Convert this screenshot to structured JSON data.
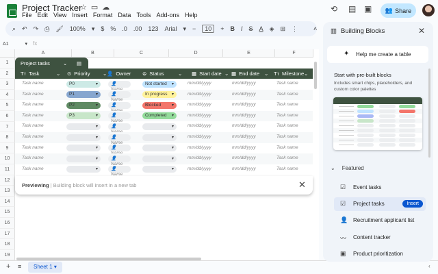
{
  "app": {
    "title": "Project Tracker",
    "menu": [
      "File",
      "Edit",
      "View",
      "Insert",
      "Format",
      "Data",
      "Tools",
      "Add-ons",
      "Help"
    ],
    "share_label": "Share"
  },
  "toolbar": {
    "zoom": "100%",
    "currency": "$",
    "percent": "%",
    "number_format": "123",
    "font": "Arial",
    "font_size": "10"
  },
  "formula_bar": {
    "name_box": "A1",
    "fx": "fx"
  },
  "columns": [
    "A",
    "B",
    "C",
    "D",
    "E",
    "F"
  ],
  "rows": [
    "1",
    "2",
    "3",
    "4",
    "5",
    "6",
    "7",
    "8",
    "9",
    "10",
    "11",
    "12",
    "13",
    "14",
    "15",
    "16",
    "17",
    "18",
    "19"
  ],
  "table": {
    "name": "Project tasks",
    "headers": [
      "Task",
      "Priority",
      "Owner",
      "Status",
      "Start date",
      "End date",
      "Milestone"
    ],
    "rows": [
      {
        "task": "Task name",
        "priority": "P0",
        "owner": "Name",
        "status": "Not started",
        "start": "mm/dd/yyyy",
        "end": "mm/dd/yyyy",
        "milestone": "Task name"
      },
      {
        "task": "Task name",
        "priority": "P1",
        "owner": "Name",
        "status": "In progress",
        "start": "mm/dd/yyyy",
        "end": "mm/dd/yyyy",
        "milestone": "Task name"
      },
      {
        "task": "Task name",
        "priority": "P2",
        "owner": "Name",
        "status": "Blocked",
        "start": "mm/dd/yyyy",
        "end": "mm/dd/yyyy",
        "milestone": "Task name"
      },
      {
        "task": "Task name",
        "priority": "P3",
        "owner": "Name",
        "status": "Completed",
        "start": "mm/dd/yyyy",
        "end": "mm/dd/yyyy",
        "milestone": "Task name"
      },
      {
        "task": "Task name",
        "priority": "",
        "owner": "Name",
        "status": "",
        "start": "mm/dd/yyyy",
        "end": "mm/dd/yyyy",
        "milestone": "Task name"
      },
      {
        "task": "Task name",
        "priority": "",
        "owner": "Name",
        "status": "",
        "start": "mm/dd/yyyy",
        "end": "mm/dd/yyyy",
        "milestone": "Task name"
      },
      {
        "task": "Task name",
        "priority": "",
        "owner": "Name",
        "status": "",
        "start": "mm/dd/yyyy",
        "end": "mm/dd/yyyy",
        "milestone": "Task name"
      },
      {
        "task": "Task name",
        "priority": "",
        "owner": "Name",
        "status": "",
        "start": "mm/dd/yyyy",
        "end": "mm/dd/yyyy",
        "milestone": "Task name"
      },
      {
        "task": "Task name",
        "priority": "",
        "owner": "Name",
        "status": "",
        "start": "mm/dd/yyyy",
        "end": "mm/dd/yyyy",
        "milestone": "Task name"
      }
    ]
  },
  "colors": {
    "priority": {
      "P0": "#cdeae6",
      "P1": "#86a6cf",
      "P2": "#5f8a63",
      "P3": "#c8e6c9",
      "": "#e8eaed"
    },
    "status": {
      "Not started": "#bfe3ff",
      "In progress": "#fff29a",
      "Blocked": "#f3756a",
      "Completed": "#93db9b",
      "": "#e8eaed"
    },
    "header_bg": "#3e5240",
    "accent": "#0b57d0"
  },
  "preview": {
    "label": "Previewing",
    "separator": " | ",
    "message": "Building block will insert in a new tab"
  },
  "panel": {
    "title": "Building Blocks",
    "help": "Help me create a table",
    "subtitle": "Start with pre-built blocks",
    "description": "Includes smart chips, placeholders, and custom color palettes",
    "section": "Featured",
    "items": [
      {
        "label": "Event tasks",
        "icon": "checklist-icon"
      },
      {
        "label": "Project tasks",
        "icon": "checklist-icon",
        "action": "Insert"
      },
      {
        "label": "Recruitment applicant list",
        "icon": "person-icon"
      },
      {
        "label": "Content tracker",
        "icon": "trend-icon"
      },
      {
        "label": "Product prioritization",
        "icon": "board-icon"
      }
    ]
  },
  "sheets": [
    {
      "name": "Sheet 1"
    }
  ]
}
